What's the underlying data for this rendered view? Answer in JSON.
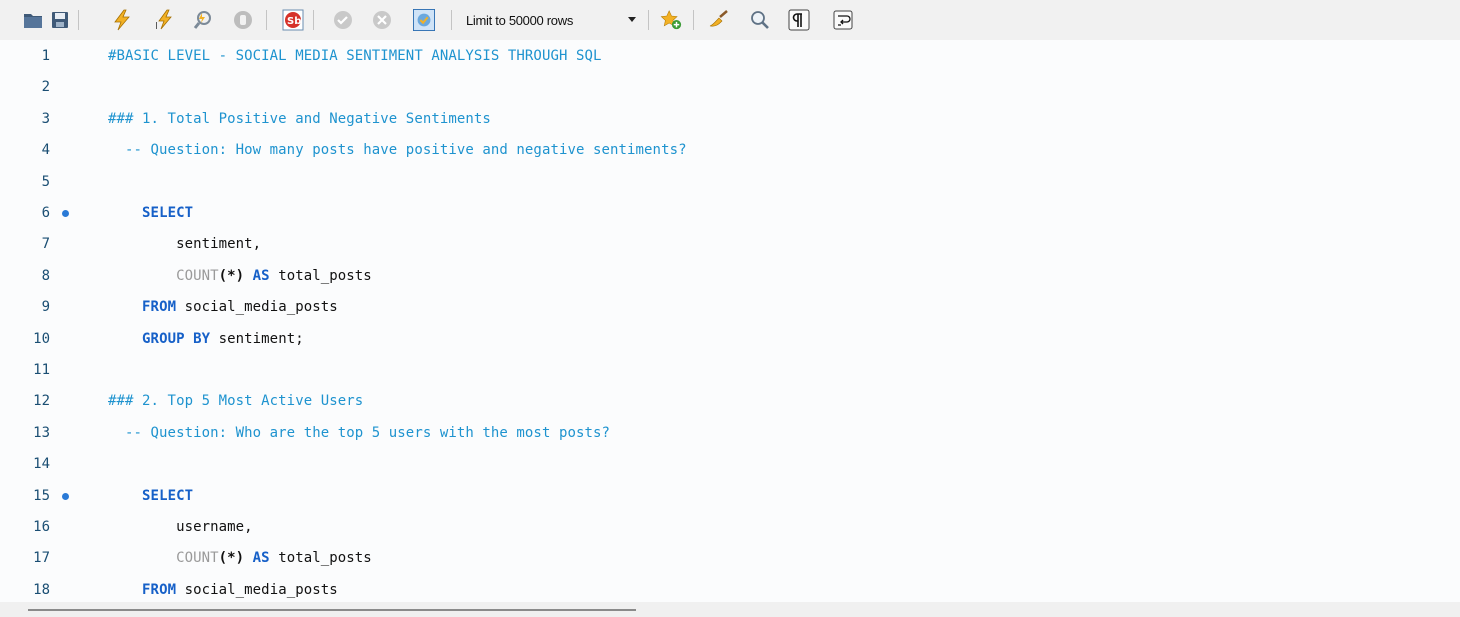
{
  "toolbar": {
    "buttons": [
      {
        "name": "open-folder-icon"
      },
      {
        "name": "save-icon"
      },
      {
        "name": "execute-all-icon"
      },
      {
        "name": "execute-statement-icon"
      },
      {
        "name": "explain-icon"
      },
      {
        "name": "stop-icon"
      },
      {
        "name": "toggle-error-stop-icon"
      },
      {
        "name": "commit-icon"
      },
      {
        "name": "rollback-icon"
      },
      {
        "name": "autocommit-icon"
      },
      {
        "name": "add-snippet-icon"
      },
      {
        "name": "beautify-icon"
      },
      {
        "name": "find-icon"
      },
      {
        "name": "invisible-chars-icon"
      },
      {
        "name": "word-wrap-icon"
      }
    ],
    "limit": {
      "selected": "Limit to 50000 rows"
    }
  },
  "colors": {
    "comment": "#1e93cf",
    "keyword": "#1660c8",
    "function": "#9a9a9a",
    "text": "#111111",
    "line_number": "#1a4e73",
    "marker": "#2a7ad6"
  },
  "editor": {
    "lines": [
      {
        "n": "1",
        "marker": false,
        "tokens": [
          {
            "t": "#BASIC LEVEL - SOCIAL MEDIA SENTIMENT ANALYSIS THROUGH SQL",
            "c": "cm"
          }
        ]
      },
      {
        "n": "2",
        "marker": false,
        "tokens": []
      },
      {
        "n": "3",
        "marker": false,
        "tokens": [
          {
            "t": "### 1. Total Positive and Negative Sentiments",
            "c": "cm"
          }
        ]
      },
      {
        "n": "4",
        "marker": false,
        "tokens": [
          {
            "t": "  -- Question: How many posts have positive and negative sentiments?",
            "c": "cm"
          }
        ]
      },
      {
        "n": "5",
        "marker": false,
        "tokens": []
      },
      {
        "n": "6",
        "marker": true,
        "tokens": [
          {
            "t": "    ",
            "c": "tx"
          },
          {
            "t": "SELECT",
            "c": "kw"
          }
        ]
      },
      {
        "n": "7",
        "marker": false,
        "tokens": [
          {
            "t": "        sentiment,",
            "c": "tx"
          }
        ]
      },
      {
        "n": "8",
        "marker": false,
        "tokens": [
          {
            "t": "        ",
            "c": "tx"
          },
          {
            "t": "COUNT",
            "c": "fn"
          },
          {
            "t": "(*)",
            "c": "ps"
          },
          {
            "t": " ",
            "c": "tx"
          },
          {
            "t": "AS",
            "c": "kw"
          },
          {
            "t": " total_posts",
            "c": "tx"
          }
        ]
      },
      {
        "n": "9",
        "marker": false,
        "tokens": [
          {
            "t": "    ",
            "c": "tx"
          },
          {
            "t": "FROM",
            "c": "kw"
          },
          {
            "t": " social_media_posts",
            "c": "tx"
          }
        ]
      },
      {
        "n": "10",
        "marker": false,
        "tokens": [
          {
            "t": "    ",
            "c": "tx"
          },
          {
            "t": "GROUP BY",
            "c": "kw"
          },
          {
            "t": " sentiment;",
            "c": "tx"
          }
        ]
      },
      {
        "n": "11",
        "marker": false,
        "tokens": []
      },
      {
        "n": "12",
        "marker": false,
        "tokens": [
          {
            "t": "### 2. Top 5 Most Active Users",
            "c": "cm"
          }
        ]
      },
      {
        "n": "13",
        "marker": false,
        "tokens": [
          {
            "t": "  -- Question: Who are the top 5 users with the most posts?",
            "c": "cm"
          }
        ]
      },
      {
        "n": "14",
        "marker": false,
        "tokens": []
      },
      {
        "n": "15",
        "marker": true,
        "tokens": [
          {
            "t": "    ",
            "c": "tx"
          },
          {
            "t": "SELECT",
            "c": "kw"
          }
        ]
      },
      {
        "n": "16",
        "marker": false,
        "tokens": [
          {
            "t": "        username,",
            "c": "tx"
          }
        ]
      },
      {
        "n": "17",
        "marker": false,
        "tokens": [
          {
            "t": "        ",
            "c": "tx"
          },
          {
            "t": "COUNT",
            "c": "fn"
          },
          {
            "t": "(*)",
            "c": "ps"
          },
          {
            "t": " ",
            "c": "tx"
          },
          {
            "t": "AS",
            "c": "kw"
          },
          {
            "t": " total_posts",
            "c": "tx"
          }
        ]
      },
      {
        "n": "18",
        "marker": false,
        "tokens": [
          {
            "t": "    ",
            "c": "tx"
          },
          {
            "t": "FROM",
            "c": "kw"
          },
          {
            "t": " social_media_posts",
            "c": "tx"
          }
        ]
      }
    ]
  }
}
